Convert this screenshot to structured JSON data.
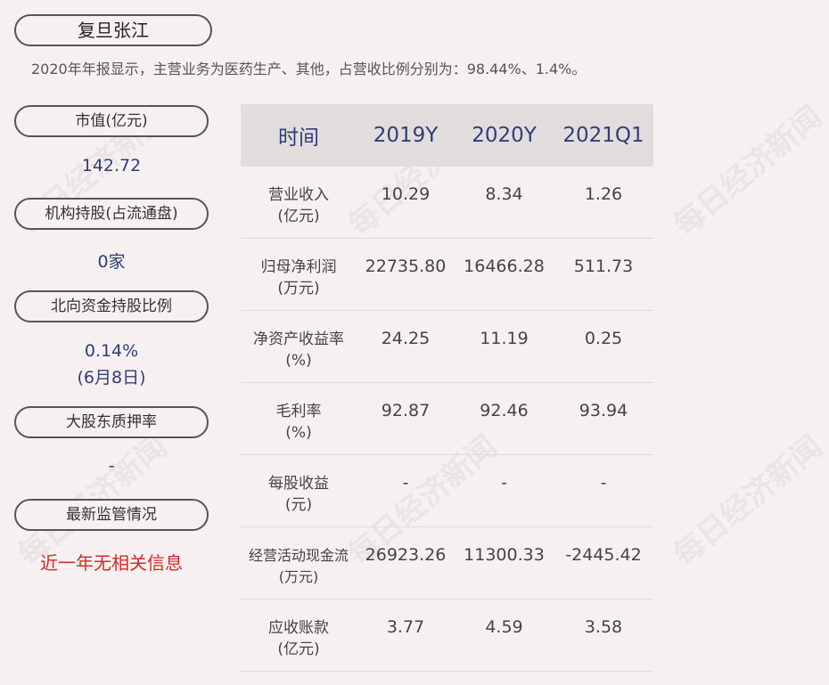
{
  "header": {
    "company": "复旦张江",
    "summary": "2020年年报显示，主营业务为医药生产、其他，占营收比例分别为：98.44%、1.4%。"
  },
  "sidebar": {
    "market_cap_label": "市值(亿元)",
    "market_cap_value": "142.72",
    "inst_label": "机构持股(占流通盘)",
    "inst_value": "0家",
    "north_label": "北向资金持股比例",
    "north_value": "0.14%",
    "north_date": "(6月8日)",
    "pledge_label": "大股东质押率",
    "pledge_value": "-",
    "reg_label": "最新监管情况",
    "reg_value": "近一年无相关信息"
  },
  "table": {
    "headers": [
      "时间",
      "2019Y",
      "2020Y",
      "2021Q1"
    ],
    "rows": [
      {
        "label1": "营业收入",
        "label2": "(亿元)",
        "values": [
          "10.29",
          "8.34",
          "1.26"
        ]
      },
      {
        "label1": "归母净利润",
        "label2": "(万元)",
        "values": [
          "22735.80",
          "16466.28",
          "511.73"
        ]
      },
      {
        "label1": "净资产收益率",
        "label2": "(%)",
        "values": [
          "24.25",
          "11.19",
          "0.25"
        ]
      },
      {
        "label1": "毛利率",
        "label2": "(%)",
        "values": [
          "92.87",
          "92.46",
          "93.94"
        ]
      },
      {
        "label1": "每股收益",
        "label2": "(元)",
        "values": [
          "-",
          "-",
          "-"
        ]
      },
      {
        "label1": "经营活动现金流",
        "label2": "(万元)",
        "values": [
          "26923.26",
          "11300.33",
          "-2445.42"
        ]
      },
      {
        "label1": "应收账款",
        "label2": "(亿元)",
        "values": [
          "3.77",
          "4.59",
          "3.58"
        ]
      }
    ]
  },
  "watermark": "每日经济新闻",
  "colors": {
    "value_blue": "#2d3f7a",
    "alert_red": "#d22a2a",
    "background": "#f7f0f0"
  }
}
